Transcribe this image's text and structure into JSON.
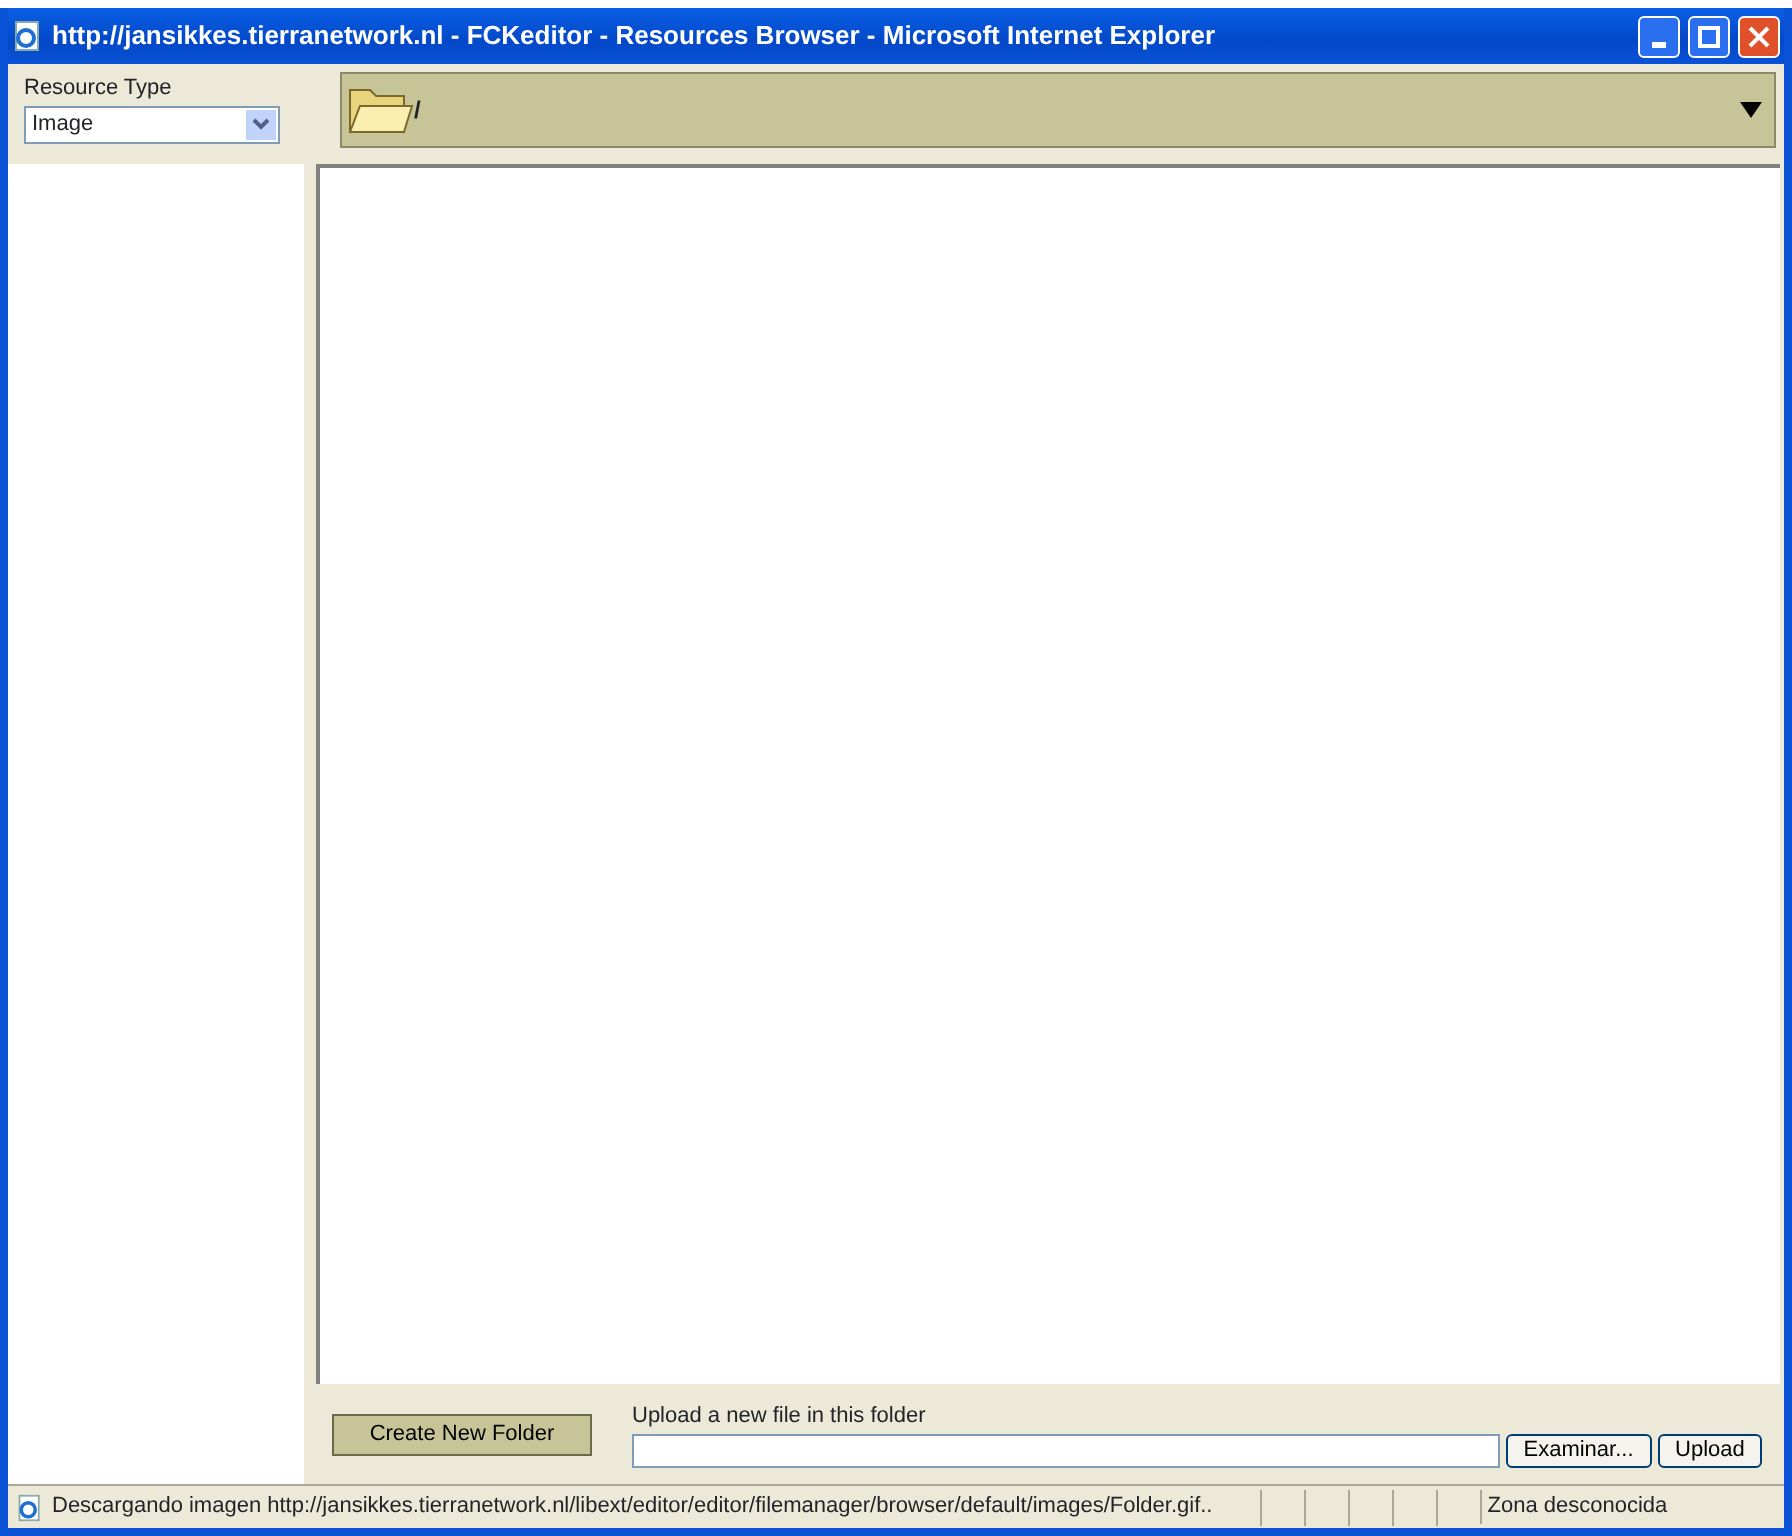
{
  "window": {
    "title": "http://jansikkes.tierranetwork.nl - FCKeditor - Resources Browser - Microsoft Internet Explorer"
  },
  "resource_type": {
    "label": "Resource Type",
    "value": "Image"
  },
  "folder_bar": {
    "path": "/"
  },
  "actions": {
    "create_folder": "Create New Folder",
    "upload_label": "Upload a new file in this folder",
    "browse": "Examinar...",
    "upload": "Upload"
  },
  "status_bar": {
    "text": "Descargando imagen http://jansikkes.tierranetwork.nl/libext/editor/editor/filemanager/browser/default/images/Folder.gif..",
    "zone": "Zona desconocida"
  }
}
